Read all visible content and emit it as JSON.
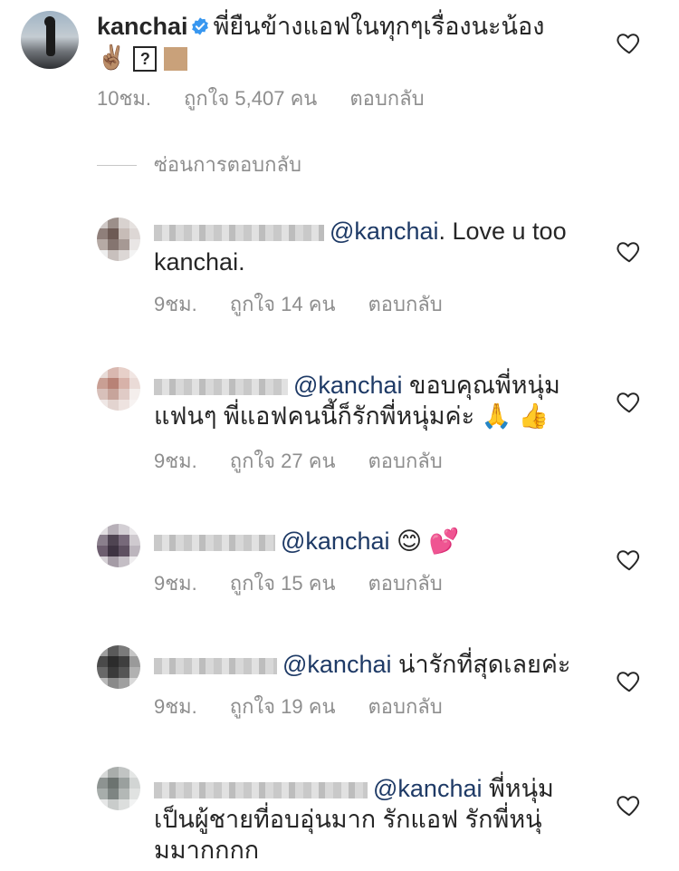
{
  "colors": {
    "mention": "#1e3a66",
    "meta": "#8e8e8e",
    "verified": "#3897f0",
    "heart": "#262626"
  },
  "main_comment": {
    "username": "kanchai",
    "verified": true,
    "text": "พี่ยืนข้างแอฟในทุกๆเรื่องนะน้อง",
    "emoji_line": "✌🏽",
    "time": "10ชม.",
    "likes": "ถูกใจ 5,407 คน",
    "reply": "ตอบกลับ"
  },
  "hide_replies": "ซ่อนการตอบกลับ",
  "replies": [
    {
      "mention": "@kanchai",
      "text_line1": ". Love u too",
      "text_line2": "kanchai.",
      "time": "9ชม.",
      "likes": "ถูกใจ 14 คน",
      "reply": "ตอบกลับ"
    },
    {
      "mention": "@kanchai",
      "text_line1": " ขอบคุณพี่หนุ่ม",
      "text_line2": "แฟนๆ พี่แอฟคนนี้ก็รักพี่หนุ่มค่ะ 🙏 👍",
      "time": "9ชม.",
      "likes": "ถูกใจ 27 คน",
      "reply": "ตอบกลับ"
    },
    {
      "mention": "@kanchai",
      "text_line1": " 😊 💕",
      "time": "9ชม.",
      "likes": "ถูกใจ 15 คน",
      "reply": "ตอบกลับ"
    },
    {
      "mention": "@kanchai",
      "text_line1": " น่ารักที่สุดเลยค่ะ",
      "time": "9ชม.",
      "likes": "ถูกใจ 19 คน",
      "reply": "ตอบกลับ"
    },
    {
      "mention": "@kanchai",
      "text_line1": " พี่หนุ่ม",
      "text_line2": "เป็นผู้ชายที่อบอุ่นมาก รักแอฟ รักพี่หนุ่",
      "text_line3": "มมากกกก"
    }
  ],
  "icons": {
    "heart": "heart-outline-icon",
    "verified": "verified-badge-icon"
  }
}
